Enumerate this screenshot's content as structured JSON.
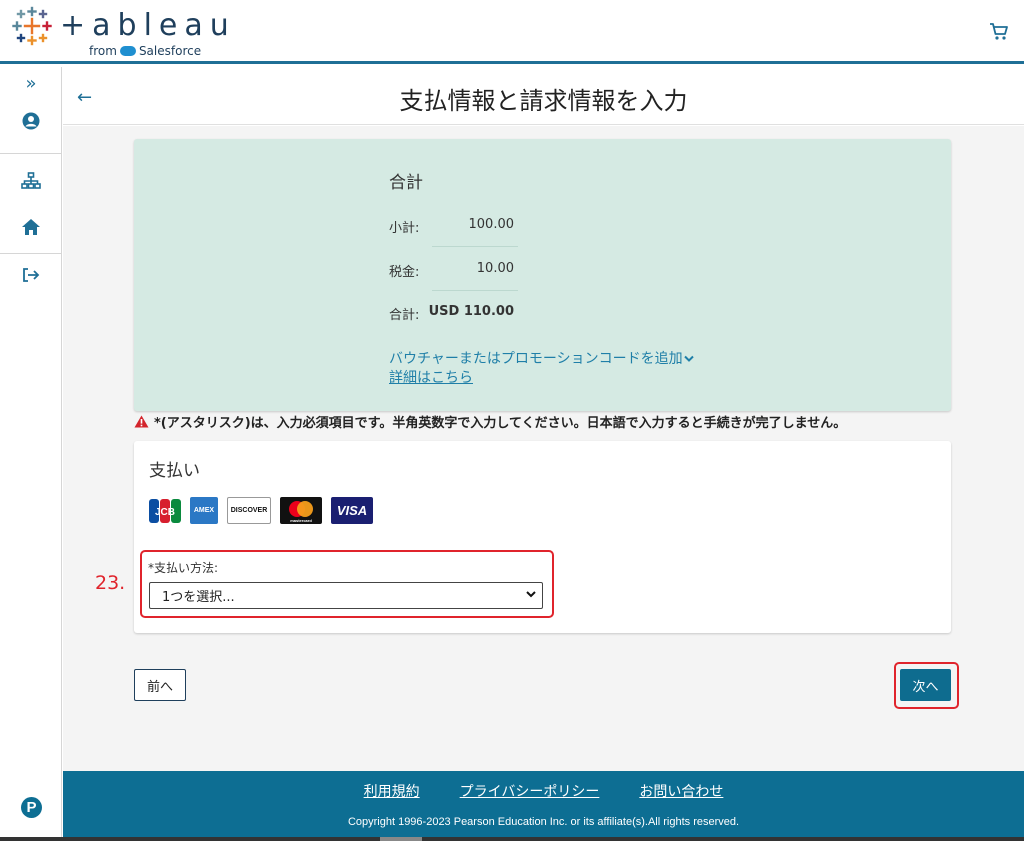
{
  "brand": {
    "logo_text": "+ableau",
    "logo_sub": "from Salesforce",
    "colors": {
      "primary": "#0d6e93",
      "accent": "#1f7fa8",
      "error": "#e0242c",
      "summary_bg": "#d5eae3"
    }
  },
  "header": {
    "cart_icon": "cart-icon"
  },
  "sidebar": {
    "items": [
      {
        "icon": "expand-icon",
        "glyph": "»"
      },
      {
        "icon": "user-icon"
      },
      {
        "icon": "org-chart-icon"
      },
      {
        "icon": "home-icon"
      },
      {
        "icon": "logout-icon"
      }
    ],
    "pearson": "P"
  },
  "page": {
    "title": "支払情報と請求情報を入力",
    "back_icon": "arrow-left-icon"
  },
  "summary": {
    "title": "合計",
    "subtotal_label": "小計:",
    "subtotal_value": "100.00",
    "tax_label": "税金:",
    "tax_value": "10.00",
    "total_label": "合計:",
    "total_value": "USD 110.00",
    "promo_link": "バウチャーまたはプロモーションコードを追加",
    "details_link": "詳細はこちら"
  },
  "warning": "*(アスタリスク)は、入力必須項目です。半角英数字で入力してください。日本語で入力すると手続きが完了しません。",
  "payment": {
    "title": "支払い",
    "cards": [
      "JCB",
      "AMEX",
      "DISCOVER",
      "mastercard",
      "VISA"
    ],
    "method_label": "*支払い方法:",
    "method_value": "1つを選択..."
  },
  "annotations": {
    "step_number": "23."
  },
  "nav": {
    "prev_label": "前へ",
    "next_label": "次へ"
  },
  "footer": {
    "links": [
      "利用規約",
      "プライバシーポリシー",
      "お問い合わせ"
    ],
    "copyright": "Copyright 1996-2023 Pearson Education Inc. or its affiliate(s).All rights reserved."
  }
}
